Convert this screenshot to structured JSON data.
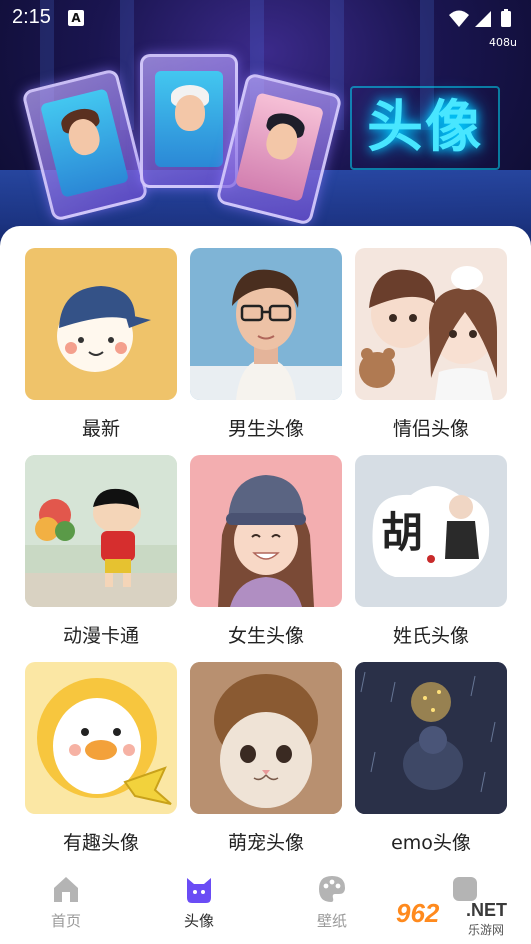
{
  "status": {
    "time": "2:15",
    "notify_glyph": "A",
    "speed": "408u"
  },
  "banner": {
    "title": "头像"
  },
  "grid": [
    {
      "label": "最新",
      "thumb": "cap-boy-cartoon",
      "bg": "#efc36a"
    },
    {
      "label": "男生头像",
      "thumb": "glasses-man-illustration",
      "bg": "#7fb4d6"
    },
    {
      "label": "情侣头像",
      "thumb": "couple-illustration",
      "bg": "#f4e6de"
    },
    {
      "label": "动漫卡通",
      "thumb": "crayon-shinchan",
      "bg": "#c9d9c4"
    },
    {
      "label": "女生头像",
      "thumb": "beanie-girl-illustration",
      "bg": "#f3aeb0"
    },
    {
      "label": "姓氏头像",
      "thumb": "surname-hu-card",
      "bg": "#d6dde4"
    },
    {
      "label": "有趣头像",
      "thumb": "duck-lion-cartoon",
      "bg": "#fbe7a4"
    },
    {
      "label": "萌宠头像",
      "thumb": "cat-lion-hat",
      "bg": "#b48d6a"
    },
    {
      "label": "emo头像",
      "thumb": "rain-night-figure",
      "bg": "#2c3147"
    }
  ],
  "thumb_text": {
    "surname": "胡"
  },
  "tabs": [
    {
      "label": "首页",
      "icon": "home-icon",
      "active": false
    },
    {
      "label": "头像",
      "icon": "cat-face-icon",
      "active": true
    },
    {
      "label": "壁纸",
      "icon": "palette-icon",
      "active": false
    },
    {
      "label": "",
      "icon": "profile-icon",
      "active": false
    }
  ],
  "colors": {
    "accent": "#6a4cf5",
    "tab_inactive": "#9a9a9a",
    "banner_title": "#48e6ff"
  },
  "watermark": {
    "main": "962",
    "net": ".NET",
    "sub": "乐游网"
  }
}
